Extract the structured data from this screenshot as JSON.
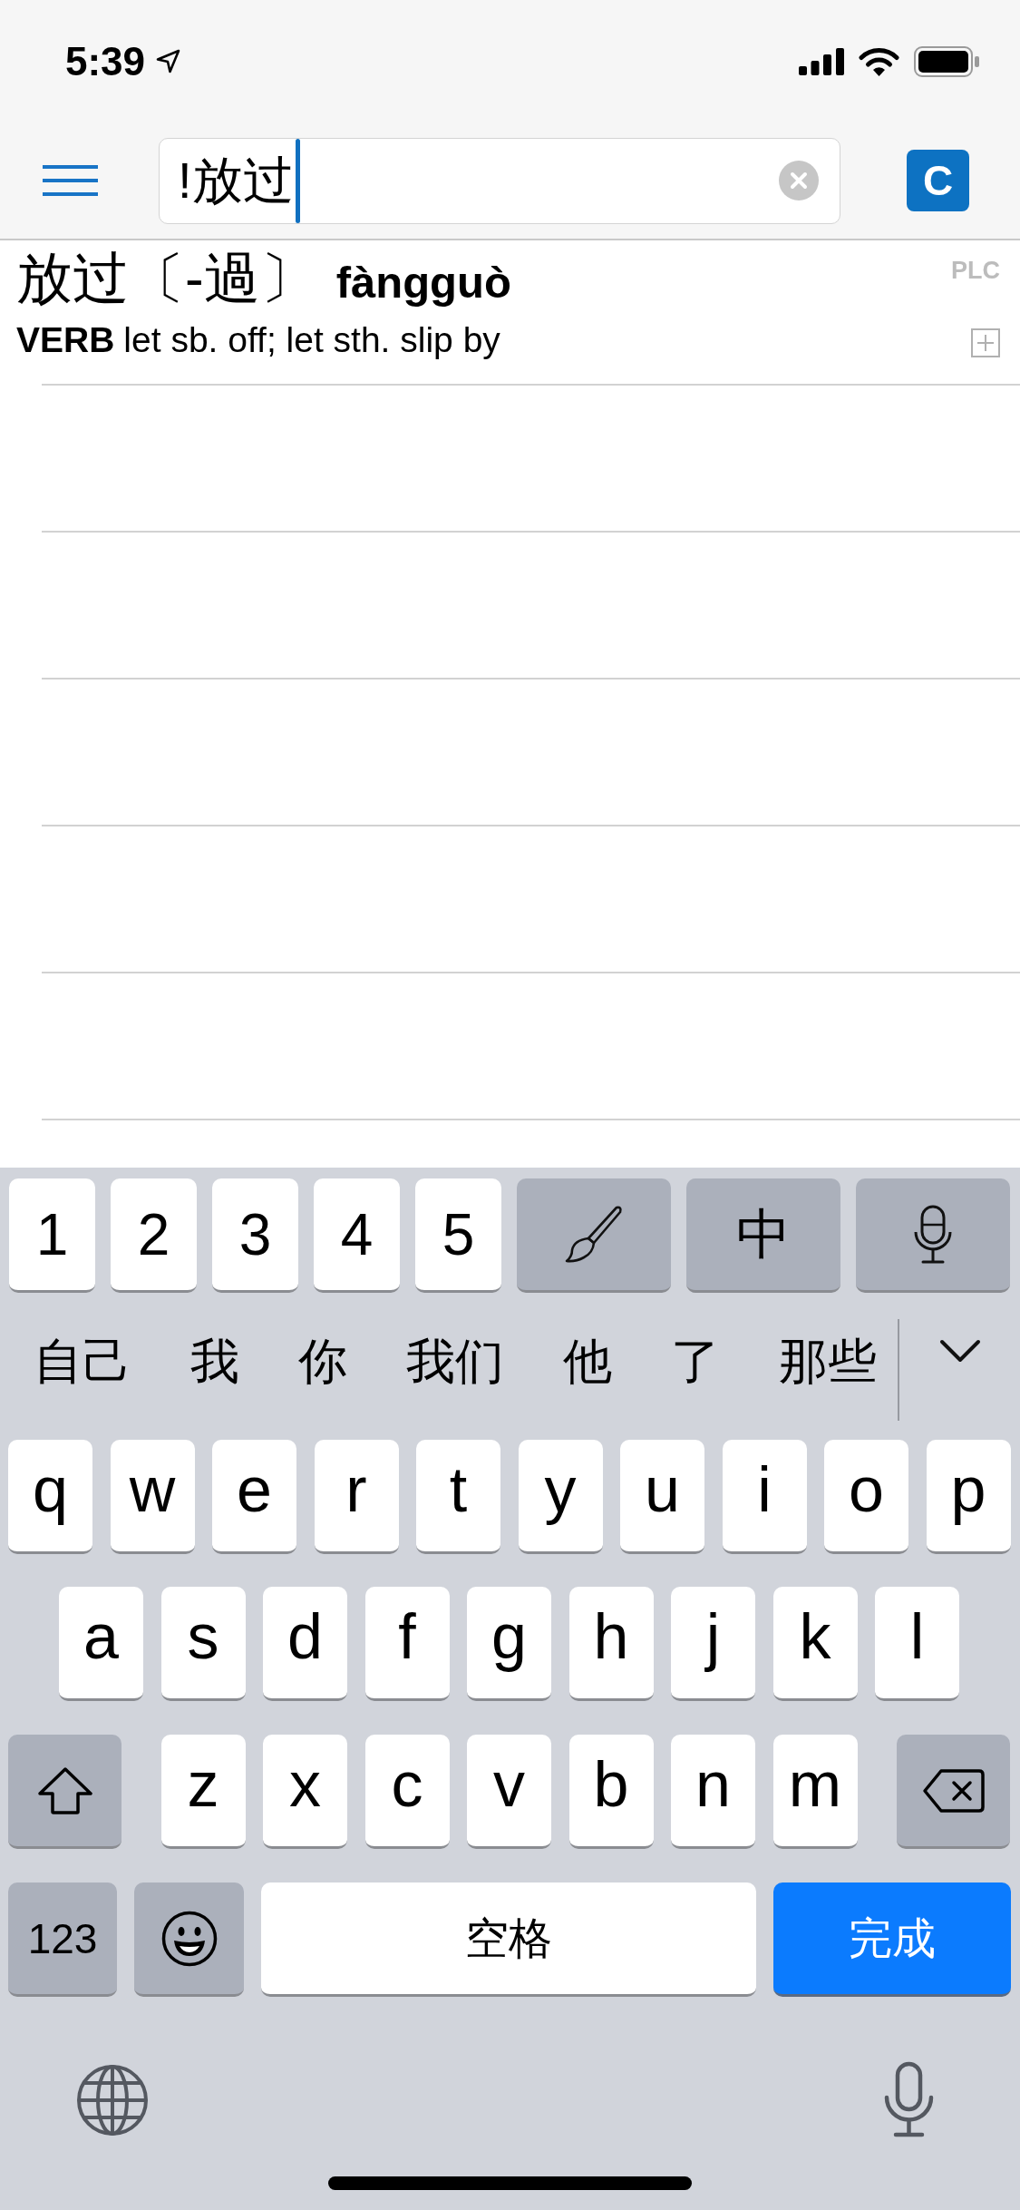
{
  "status_bar": {
    "time": "5:39"
  },
  "header": {
    "search_field": {
      "value": "!放过"
    },
    "mode_button": {
      "label": "C"
    }
  },
  "results": [
    {
      "headword": "放过〔-過〕",
      "pinyin": "fàngguò",
      "source": "PLC",
      "part_of_speech": "VERB",
      "definition": "let sb. off; let sth. slip by"
    }
  ],
  "keyboard": {
    "top_row": [
      {
        "kind": "key",
        "label": "1"
      },
      {
        "kind": "key",
        "label": "2"
      },
      {
        "kind": "key",
        "label": "3"
      },
      {
        "kind": "key",
        "label": "4"
      },
      {
        "kind": "key",
        "label": "5"
      },
      {
        "kind": "brush"
      },
      {
        "kind": "function",
        "label": "中"
      },
      {
        "kind": "mic"
      }
    ],
    "candidates": [
      "自己",
      "我",
      "你",
      "我们",
      "他",
      "了",
      "那些"
    ],
    "letter_rows": [
      [
        {
          "kind": "key",
          "label": "q"
        },
        {
          "kind": "key",
          "label": "w"
        },
        {
          "kind": "key",
          "label": "e"
        },
        {
          "kind": "key",
          "label": "r"
        },
        {
          "kind": "key",
          "label": "t"
        },
        {
          "kind": "key",
          "label": "y"
        },
        {
          "kind": "key",
          "label": "u"
        },
        {
          "kind": "key",
          "label": "i"
        },
        {
          "kind": "key",
          "label": "o"
        },
        {
          "kind": "key",
          "label": "p"
        }
      ],
      [
        {
          "kind": "key",
          "label": "a"
        },
        {
          "kind": "key",
          "label": "s"
        },
        {
          "kind": "key",
          "label": "d"
        },
        {
          "kind": "key",
          "label": "f"
        },
        {
          "kind": "key",
          "label": "g"
        },
        {
          "kind": "key",
          "label": "h"
        },
        {
          "kind": "key",
          "label": "j"
        },
        {
          "kind": "key",
          "label": "k"
        },
        {
          "kind": "key",
          "label": "l"
        }
      ],
      [
        {
          "kind": "shift"
        },
        {
          "kind": "key",
          "label": "z"
        },
        {
          "kind": "key",
          "label": "x"
        },
        {
          "kind": "key",
          "label": "c"
        },
        {
          "kind": "key",
          "label": "v"
        },
        {
          "kind": "key",
          "label": "b"
        },
        {
          "kind": "key",
          "label": "n"
        },
        {
          "kind": "key",
          "label": "m"
        },
        {
          "kind": "delete"
        }
      ]
    ],
    "bottom_row": [
      {
        "kind": "function",
        "label": "123"
      },
      {
        "kind": "emoji"
      },
      {
        "kind": "space",
        "label": "空格"
      },
      {
        "kind": "return",
        "label": "完成"
      }
    ]
  }
}
